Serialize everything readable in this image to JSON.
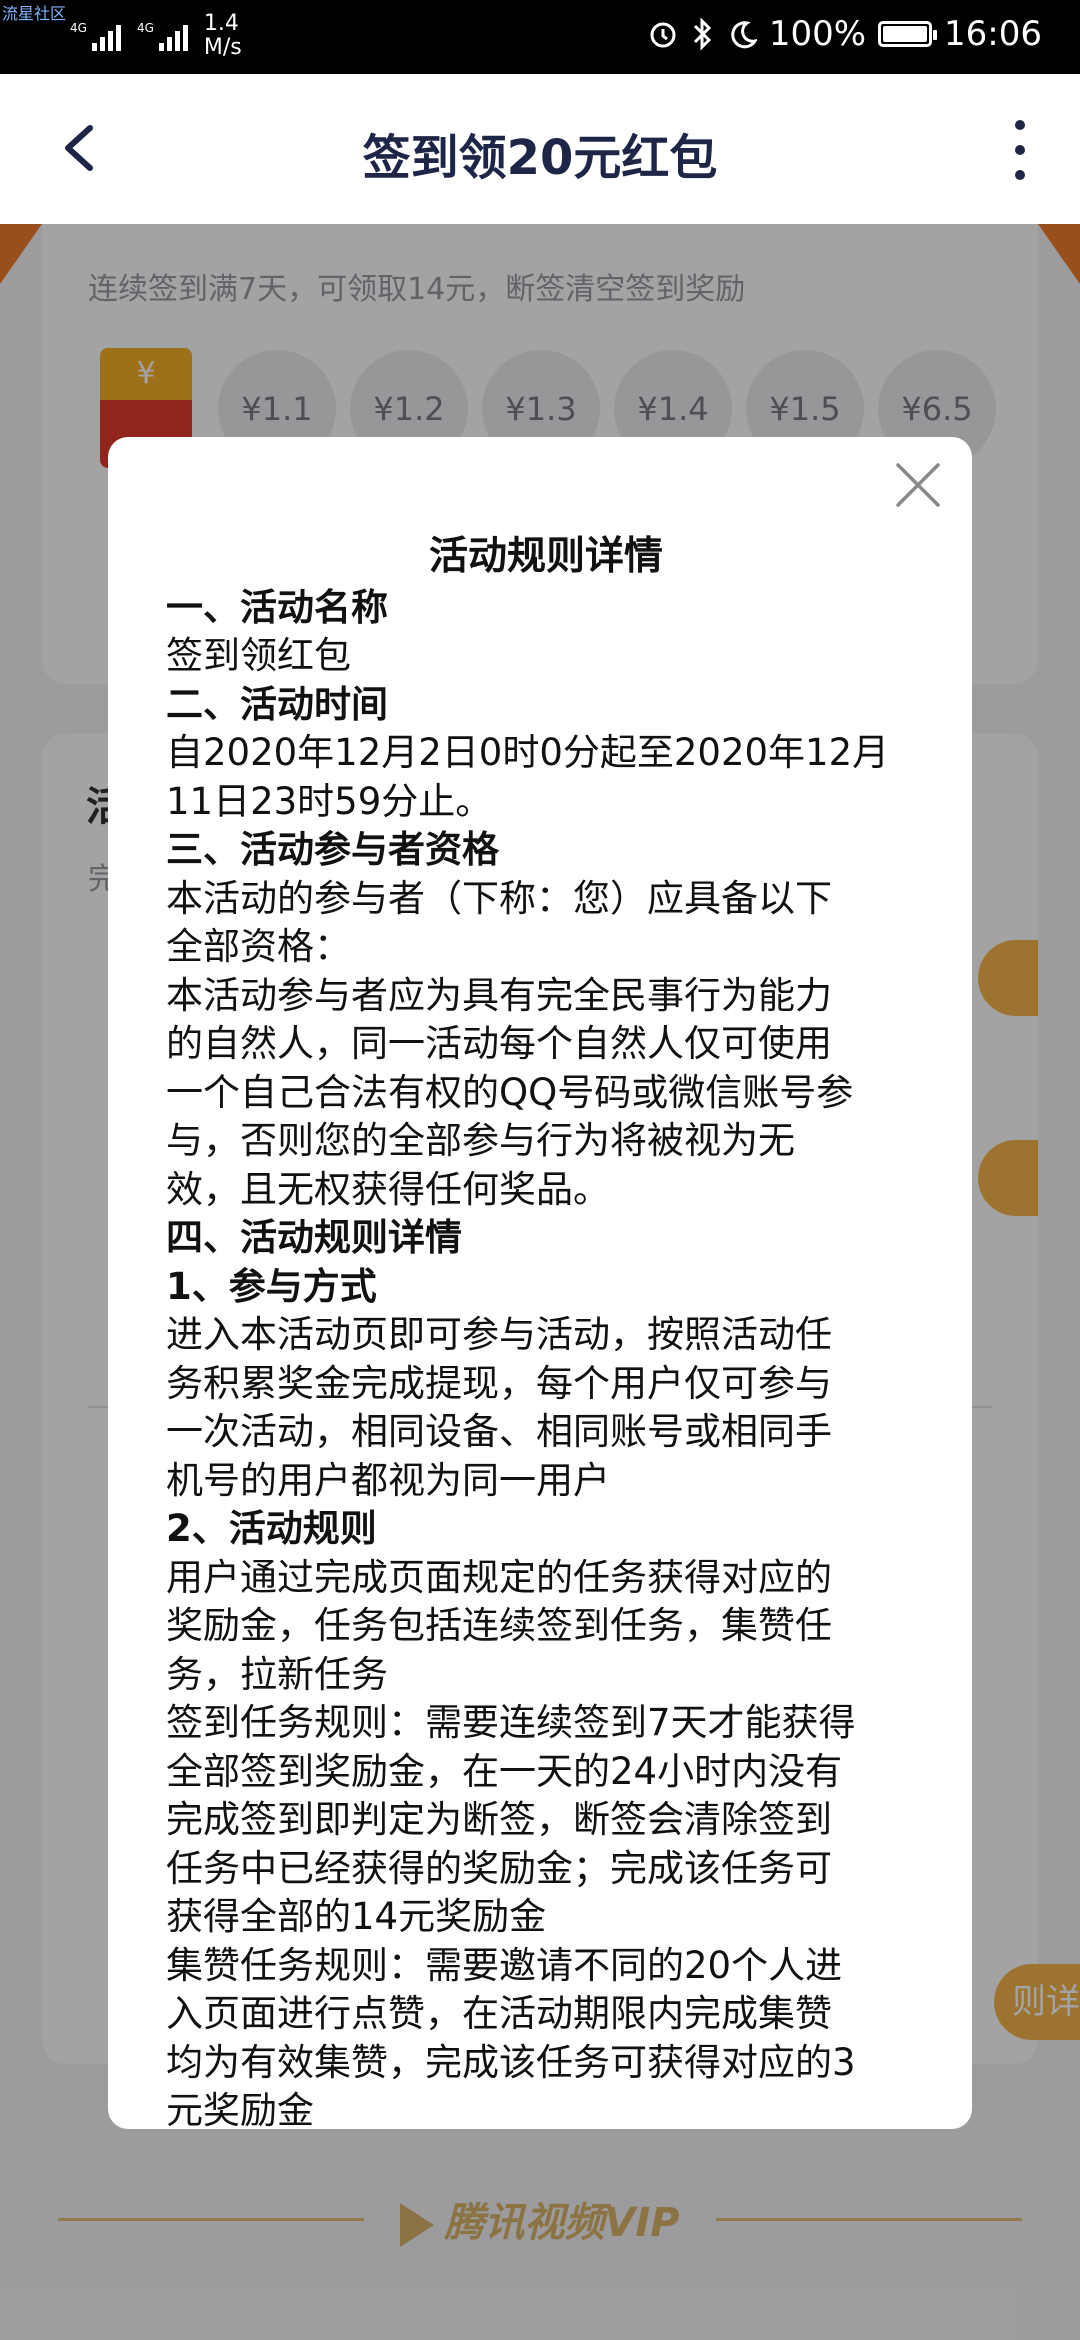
{
  "status_bar": {
    "watermark": "流星社区",
    "net1": "4G",
    "net2": "4G",
    "speed_value": "1.4",
    "speed_unit": "M/s",
    "battery": "100%",
    "time": "16:06"
  },
  "nav": {
    "title": "签到领20元红包"
  },
  "background": {
    "signin_desc": "连续签到满7天，可领取14元，断签清空签到奖励",
    "redpack_symbol": "¥",
    "coins": [
      "¥1.1",
      "¥1.2",
      "¥1.3",
      "¥1.4",
      "¥1.5",
      "¥6.5"
    ],
    "section_letter": "活",
    "section_sub": "完",
    "side_pill": "则详情",
    "footer_brand": "腾讯视频VIP"
  },
  "modal": {
    "title": "活动规则详情",
    "lines": [
      {
        "text": "一、活动名称",
        "heading": true
      },
      {
        "text": "签到领红包",
        "heading": false
      },
      {
        "text": "二、活动时间",
        "heading": true
      },
      {
        "text": "自2020年12月2日0时0分起至2020年12月",
        "heading": false
      },
      {
        "text": "11日23时59分止。",
        "heading": false
      },
      {
        "text": "三、活动参与者资格",
        "heading": true
      },
      {
        "text": "本活动的参与者（下称：您）应具备以下",
        "heading": false
      },
      {
        "text": "全部资格：",
        "heading": false
      },
      {
        "text": "本活动参与者应为具有完全民事行为能力",
        "heading": false
      },
      {
        "text": "的自然人，同一活动每个自然人仅可使用",
        "heading": false
      },
      {
        "text": "一个自己合法有权的QQ号码或微信账号参",
        "heading": false
      },
      {
        "text": "与，否则您的全部参与行为将被视为无",
        "heading": false
      },
      {
        "text": "效，且无权获得任何奖品。",
        "heading": false
      },
      {
        "text": "四、活动规则详情",
        "heading": true
      },
      {
        "text": "1、参与方式",
        "heading": true
      },
      {
        "text": "进入本活动页即可参与活动，按照活动任",
        "heading": false
      },
      {
        "text": "务积累奖金完成提现，每个用户仅可参与",
        "heading": false
      },
      {
        "text": "一次活动，相同设备、相同账号或相同手",
        "heading": false
      },
      {
        "text": "机号的用户都视为同一用户",
        "heading": false
      },
      {
        "text": "2、活动规则",
        "heading": true
      },
      {
        "text": "用户通过完成页面规定的任务获得对应的",
        "heading": false
      },
      {
        "text": "奖励金，任务包括连续签到任务，集赞任",
        "heading": false
      },
      {
        "text": "务，拉新任务",
        "heading": false
      },
      {
        "text": "签到任务规则：需要连续签到7天才能获得",
        "heading": false
      },
      {
        "text": "全部签到奖励金，在一天的24小时内没有",
        "heading": false
      },
      {
        "text": "完成签到即判定为断签，断签会清除签到",
        "heading": false
      },
      {
        "text": "任务中已经获得的奖励金；完成该任务可",
        "heading": false
      },
      {
        "text": "获得全部的14元奖励金",
        "heading": false
      },
      {
        "text": "集赞任务规则：需要邀请不同的20个人进",
        "heading": false
      },
      {
        "text": "入页面进行点赞，在活动期限内完成集赞",
        "heading": false
      },
      {
        "text": "均为有效集赞，完成该任务可获得对应的3",
        "heading": false
      },
      {
        "text": "元奖励金",
        "heading": false
      }
    ]
  }
}
